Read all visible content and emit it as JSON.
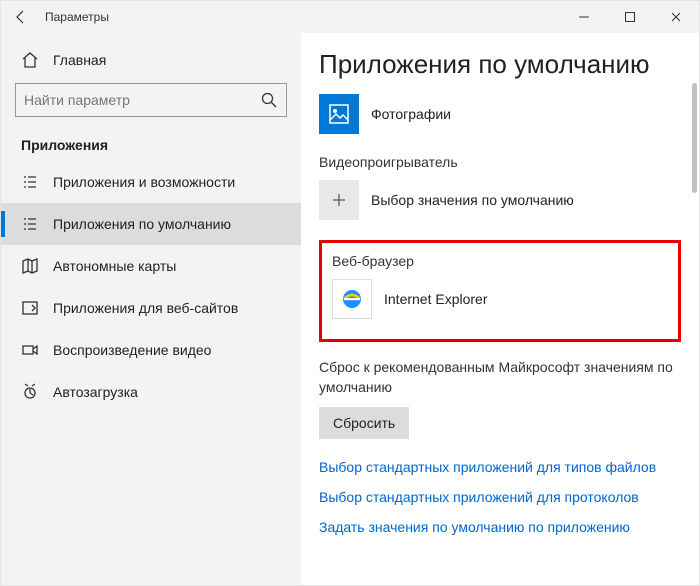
{
  "window": {
    "title": "Параметры"
  },
  "sidebar": {
    "home": "Главная",
    "search_placeholder": "Найти параметр",
    "section": "Приложения",
    "items": [
      {
        "label": "Приложения и возможности"
      },
      {
        "label": "Приложения по умолчанию"
      },
      {
        "label": "Автономные карты"
      },
      {
        "label": "Приложения для веб-сайтов"
      },
      {
        "label": "Воспроизведение видео"
      },
      {
        "label": "Автозагрузка"
      }
    ]
  },
  "main": {
    "title": "Приложения по умолчанию",
    "photos_app": "Фотографии",
    "video_label": "Видеопроигрыватель",
    "video_default": "Выбор значения по умолчанию",
    "browser_label": "Веб-браузер",
    "browser_app": "Internet Explorer",
    "reset_text": "Сброс к рекомендованным Майкрософт значениям по умолчанию",
    "reset_btn": "Сбросить",
    "link1": "Выбор стандартных приложений для типов файлов",
    "link2": "Выбор стандартных приложений для протоколов",
    "link3": "Задать значения по умолчанию по приложению"
  }
}
